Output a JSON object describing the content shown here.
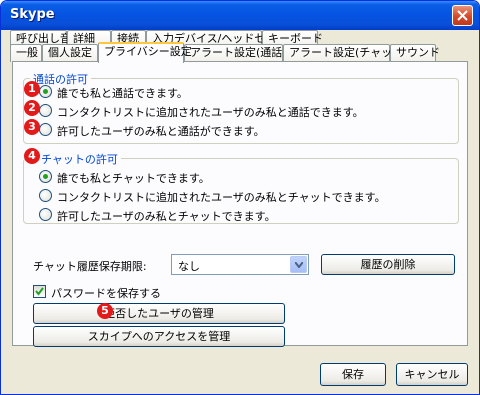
{
  "window": {
    "title": "Skype"
  },
  "tabs_row1": [
    "呼び出し音",
    "詳細",
    "接続",
    "入力デバイス/ヘッドセット",
    "キーボード"
  ],
  "tabs_row2": [
    "一般",
    "個人設定",
    "プライバシー設定",
    "アラート設定(通話)",
    "アラート設定(チャット)",
    "サウンド"
  ],
  "selected_tab": "プライバシー設定",
  "call_group": {
    "label": "通話の許可",
    "options": [
      "誰でも私と通話できます。",
      "コンタクトリストに追加されたユーザのみ私と通話できます。",
      "許可したユーザのみ私と通話ができます。"
    ],
    "selected_index": 0
  },
  "chat_group": {
    "label": "チャットの許可",
    "options": [
      "誰でも私とチャットできます。",
      "コンタクトリストに追加されたユーザのみ私とチャットできます。",
      "許可したユーザのみ私とチャットできます。"
    ],
    "selected_index": 0
  },
  "markers": [
    "1",
    "2",
    "3",
    "4",
    "5"
  ],
  "history": {
    "label": "チャット履歴保存期限:",
    "value": "なし",
    "delete_button": "履歴の削除"
  },
  "save_password": {
    "label": "パスワードを保存する",
    "checked": true
  },
  "buttons": {
    "blocked_users": "拒否したユーザの管理",
    "skype_access": "スカイプへのアクセスを管理",
    "save": "保存",
    "cancel": "キャンセル"
  },
  "colors": {
    "titlebar": "#0554e3",
    "group_label": "#0046d5",
    "marker": "#e21a1a",
    "radio_dot": "#21a121"
  }
}
